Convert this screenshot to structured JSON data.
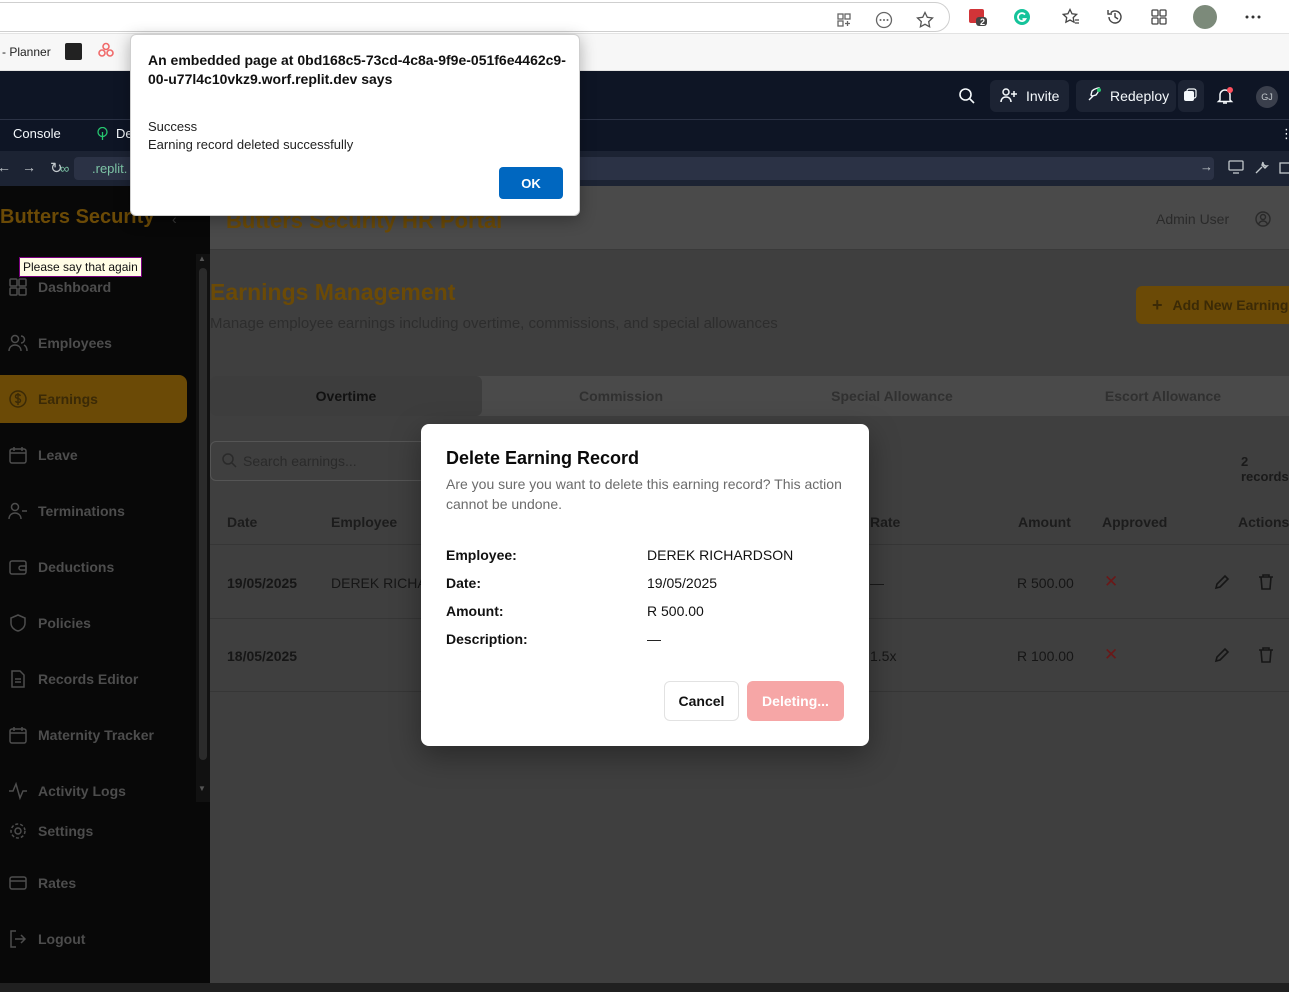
{
  "browser": {
    "bookmark_planner": "- Planner",
    "ext_badge": "2"
  },
  "replit": {
    "invite": "Invite",
    "redeploy": "Redeploy",
    "avatar": "GJ",
    "tab_console": "Console",
    "tab_de": "De",
    "url": ".replit."
  },
  "alert": {
    "title": "An embedded page at 0bd168c5-73cd-4c8a-9f9e-051f6e4462c9-00-u77l4c10vkz9.worf.replit.dev says",
    "line1": "Success",
    "line2": "Earning record deleted successfully",
    "ok": "OK"
  },
  "tooltip": "Please say that again",
  "sidebar": {
    "brand": "Butters Security",
    "items": [
      {
        "label": "Dashboard",
        "icon": "dashboard-icon"
      },
      {
        "label": "Employees",
        "icon": "users-icon"
      },
      {
        "label": "Earnings",
        "icon": "dollar-icon"
      },
      {
        "label": "Leave",
        "icon": "calendar-icon"
      },
      {
        "label": "Terminations",
        "icon": "user-minus-icon"
      },
      {
        "label": "Deductions",
        "icon": "wallet-icon"
      },
      {
        "label": "Policies",
        "icon": "shield-icon"
      },
      {
        "label": "Records Editor",
        "icon": "file-icon"
      },
      {
        "label": "Maternity Tracker",
        "icon": "calendar-icon"
      },
      {
        "label": "Activity Logs",
        "icon": "activity-icon"
      },
      {
        "label": "Settings",
        "icon": "gear-icon"
      },
      {
        "label": "Rates",
        "icon": "card-icon"
      },
      {
        "label": "Logout",
        "icon": "logout-icon"
      }
    ]
  },
  "header": {
    "title": "Butters Security HR Portal",
    "user": "Admin User"
  },
  "page": {
    "title": "Earnings Management",
    "subtitle": "Manage employee earnings including overtime, commissions, and special allowances",
    "add_button": "Add New Earning",
    "tabs": [
      "Overtime",
      "Commission",
      "Special Allowance",
      "Escort Allowance"
    ],
    "search_placeholder": "Search earnings...",
    "records_count": "2 records"
  },
  "table": {
    "columns": [
      "Date",
      "Employee",
      "Rate",
      "Amount",
      "Approved",
      "Actions"
    ],
    "rows": [
      {
        "date": "19/05/2025",
        "employee": "DEREK RICHAR",
        "rate": "—",
        "amount": "R 500.00"
      },
      {
        "date": "18/05/2025",
        "employee": "",
        "rate": "1.5x",
        "amount": "R 100.00"
      }
    ]
  },
  "dialog": {
    "title": "Delete Earning Record",
    "description": "Are you sure you want to delete this earning record? This action cannot be undone.",
    "fields": [
      {
        "label": "Employee:",
        "value": "DEREK RICHARDSON"
      },
      {
        "label": "Date:",
        "value": "19/05/2025"
      },
      {
        "label": "Amount:",
        "value": "R 500.00"
      },
      {
        "label": "Description:",
        "value": "—"
      }
    ],
    "cancel": "Cancel",
    "confirm": "Deleting..."
  },
  "colors": {
    "brand": "#6b4a06",
    "danger_light": "#f6a6a6",
    "alert_button": "#0067c0"
  }
}
